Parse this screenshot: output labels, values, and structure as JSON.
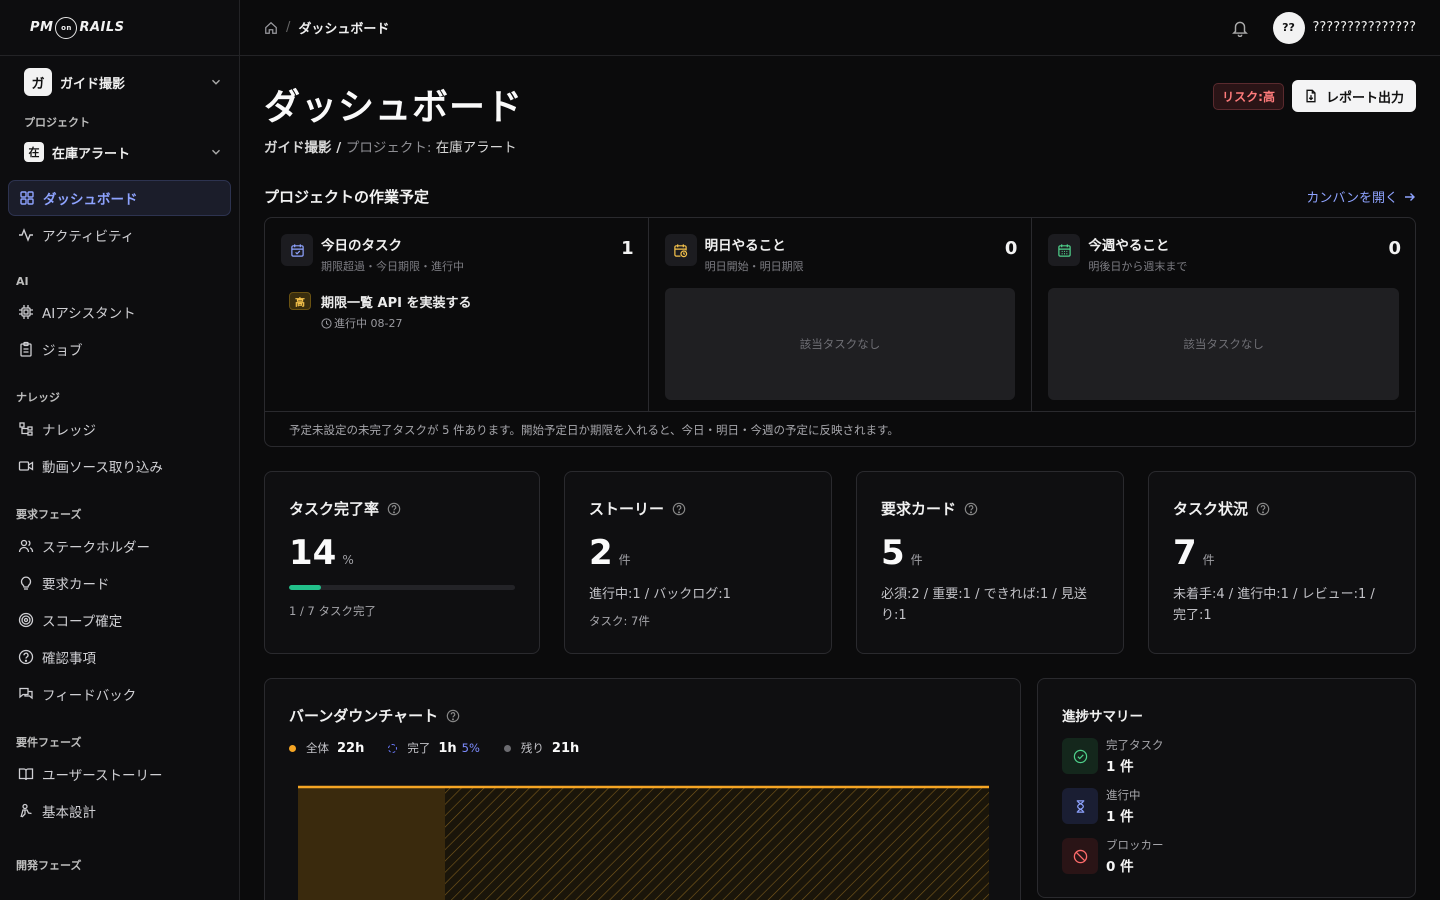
{
  "app": {
    "logo_left": "PM",
    "logo_mid": "on",
    "logo_right": "RAILS"
  },
  "sidebar": {
    "workspace": {
      "initial": "ガ",
      "name": "ガイド撮影"
    },
    "project_label": "プロジェクト",
    "project": {
      "initial": "在",
      "name": "在庫アラート"
    },
    "items_top": [
      {
        "label": "ダッシュボード",
        "icon": "grid-icon",
        "active": true
      },
      {
        "label": "アクティビティ",
        "icon": "activity-icon"
      }
    ],
    "sections": [
      {
        "title": "AI",
        "items": [
          {
            "label": "AIアシスタント",
            "icon": "chip-icon"
          },
          {
            "label": "ジョブ",
            "icon": "clipboard-icon"
          }
        ]
      },
      {
        "title": "ナレッジ",
        "items": [
          {
            "label": "ナレッジ",
            "icon": "tree-icon"
          },
          {
            "label": "動画ソース取り込み",
            "icon": "video-icon"
          }
        ]
      },
      {
        "title": "要求フェーズ",
        "items": [
          {
            "label": "ステークホルダー",
            "icon": "users-icon"
          },
          {
            "label": "要求カード",
            "icon": "bulb-icon"
          },
          {
            "label": "スコープ確定",
            "icon": "target-icon"
          },
          {
            "label": "確認事項",
            "icon": "question-icon"
          },
          {
            "label": "フィードバック",
            "icon": "chat-icon"
          }
        ]
      },
      {
        "title": "要件フェーズ",
        "items": [
          {
            "label": "ユーザーストーリー",
            "icon": "book-icon"
          },
          {
            "label": "基本設計",
            "icon": "person-icon"
          }
        ]
      },
      {
        "title": "開発フェーズ",
        "items": []
      }
    ]
  },
  "topbar": {
    "breadcrumb_current": "ダッシュボード",
    "user_initials": "??",
    "user_name": "???????????????"
  },
  "header": {
    "title": "ダッシュボード",
    "sub_workspace": "ガイド撮影",
    "sub_sep": " / ",
    "sub_project_label": "プロジェクト: ",
    "sub_project": "在庫アラート",
    "risk_badge": "リスク:高",
    "report_button": "レポート出力"
  },
  "schedule": {
    "title": "プロジェクトの作業予定",
    "kanban_link": "カンバンを開く",
    "today": {
      "title": "今日のタスク",
      "desc": "期限超過・今日期限・進行中",
      "count": "1",
      "task": {
        "priority": "高",
        "title": "期限一覧 API を実装する",
        "meta": "進行中 08-27"
      }
    },
    "tomorrow": {
      "title": "明日やること",
      "desc": "明日開始・明日期限",
      "count": "0",
      "empty": "該当タスクなし"
    },
    "week": {
      "title": "今週やること",
      "desc": "明後日から週末まで",
      "count": "0",
      "empty": "該当タスクなし"
    },
    "footer": "予定未設定の未完了タスクが 5 件あります。開始予定日か期限を入れると、今日・明日・今週の予定に反映されます。"
  },
  "stats": [
    {
      "title": "タスク完了率",
      "value": "14",
      "unit": "%",
      "progress": 0.14,
      "desc": "1 / 7 タスク完了"
    },
    {
      "title": "ストーリー",
      "value": "2",
      "unit": "件",
      "desc": "進行中:1 / バックログ:1",
      "desc2": "タスク: 7件"
    },
    {
      "title": "要求カード",
      "value": "5",
      "unit": "件",
      "desc": "必須:2 / 重要:1 / できれば:1 / 見送り:1"
    },
    {
      "title": "タスク状況",
      "value": "7",
      "unit": "件",
      "desc": "未着手:4 / 進行中:1 / レビュー:1 / 完了:1"
    }
  ],
  "burndown": {
    "title": "バーンダウンチャート",
    "legend_total_label": "全体",
    "legend_total_value": "22h",
    "legend_done_label": "完了",
    "legend_done_value": "1h",
    "legend_done_pct": "5%",
    "legend_remain_label": "残り",
    "legend_remain_value": "21h",
    "colors": {
      "total": "#f5a524",
      "done": "#6b7cff",
      "remain": "#6b6b70"
    }
  },
  "summary": {
    "title": "進捗サマリー",
    "items": [
      {
        "label": "完了タスク",
        "value": "1 件"
      },
      {
        "label": "進行中",
        "value": "1 件"
      },
      {
        "label": "ブロッカー",
        "value": "0 件"
      }
    ]
  }
}
